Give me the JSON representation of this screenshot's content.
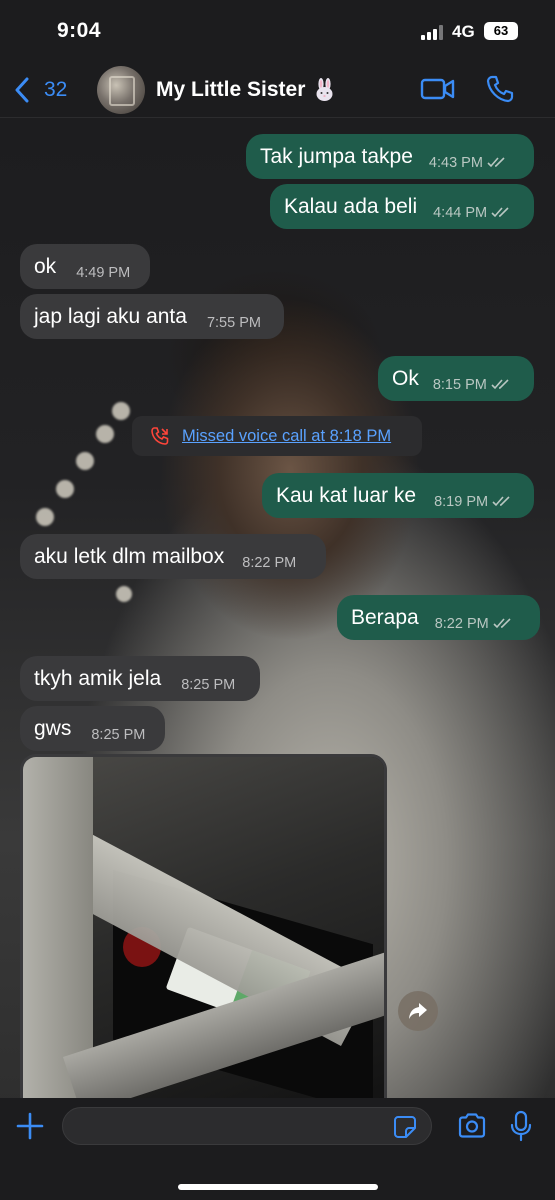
{
  "status_bar": {
    "time": "9:04",
    "network": "4G",
    "battery": "63"
  },
  "header": {
    "back_count": "32",
    "contact_name": "My Little Sister"
  },
  "messages": [
    {
      "text": "Tak jumpa takpe",
      "time": "4:43 PM",
      "direction": "outgoing",
      "read": true
    },
    {
      "text": "Kalau ada beli",
      "time": "4:44 PM",
      "direction": "outgoing",
      "read": true
    },
    {
      "text": "ok",
      "time": "4:49 PM",
      "direction": "incoming"
    },
    {
      "text": "jap lagi aku anta",
      "time": "7:55 PM",
      "direction": "incoming"
    },
    {
      "text": "Ok",
      "time": "8:15 PM",
      "direction": "outgoing",
      "read": true
    },
    {
      "text": "Kau kat luar ke",
      "time": "8:19 PM",
      "direction": "outgoing",
      "read": true
    },
    {
      "text": "aku letk dlm mailbox",
      "time": "8:22 PM",
      "direction": "incoming"
    },
    {
      "text": "Berapa",
      "time": "8:22 PM",
      "direction": "outgoing",
      "read": true
    },
    {
      "text": "tkyh amik jela",
      "time": "8:25 PM",
      "direction": "incoming"
    },
    {
      "text": "gws",
      "time": "8:25 PM",
      "direction": "incoming"
    }
  ],
  "missed_call": {
    "text": "Missed voice call at 8:18 PM"
  },
  "input": {
    "placeholder": ""
  },
  "colors": {
    "accent": "#3b8cf5",
    "outgoing_bubble": "#1f5c4b",
    "incoming_bubble": "#3a3a3c",
    "missed_call_red": "#ff453a"
  },
  "icons": [
    "chevron-left-icon",
    "bunny-icon",
    "video-camera-icon",
    "phone-icon",
    "missed-call-icon",
    "forward-icon",
    "plus-icon",
    "sticker-icon",
    "camera-icon",
    "microphone-icon",
    "double-check-icon"
  ]
}
